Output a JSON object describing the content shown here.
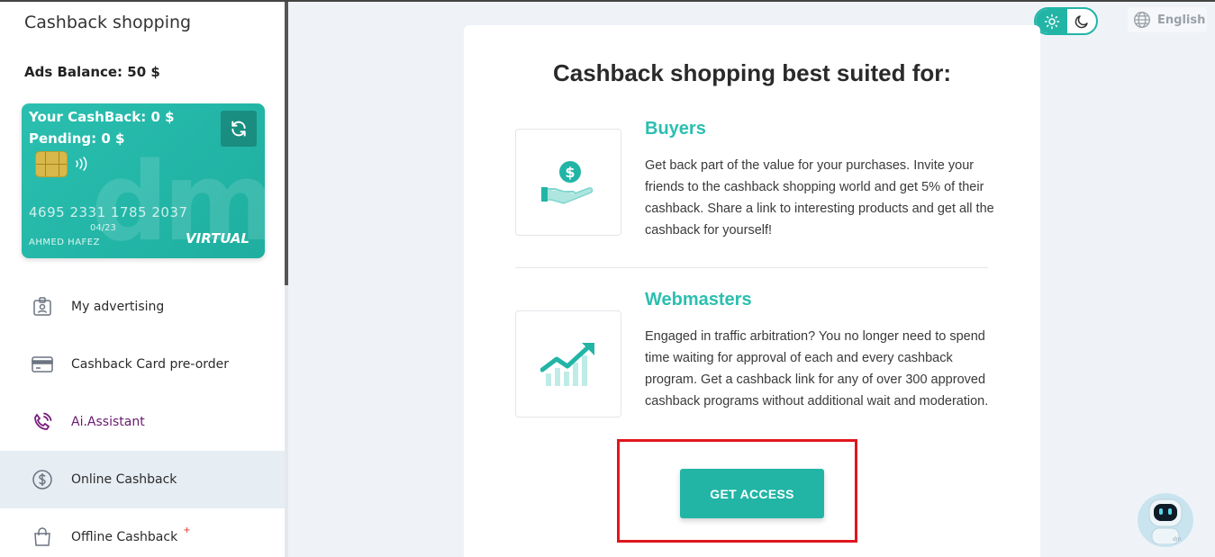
{
  "sidebar": {
    "app_title": "Cashback shopping",
    "ads_balance": "Ads Balance: 50 $",
    "card": {
      "cashback": "Your CashBack: 0 $",
      "pending": "Pending: 0 $",
      "number": "4695 2331 1785 2037",
      "expiry": "04/23",
      "holder": "AHMED HAFEZ",
      "brand": "VIRTUAL",
      "watermark": "dm"
    },
    "items": [
      {
        "label": "My advertising",
        "icon": "badge-icon"
      },
      {
        "label": "Cashback Card pre-order",
        "icon": "credit-card-icon"
      },
      {
        "label": "Ai.Assistant",
        "icon": "phone-call-icon"
      },
      {
        "label": "Online Cashback",
        "icon": "dollar-circle-icon",
        "active": true
      },
      {
        "label": "Offline Cashback",
        "icon": "shopping-bag-icon",
        "badge": "+"
      }
    ]
  },
  "header": {
    "language": "English"
  },
  "main": {
    "title": "Cashback shopping best suited for:",
    "features": [
      {
        "title": "Buyers",
        "text": "Get back part of the value for your purchases. Invite your friends to the cashback shopping world and get 5% of their cashback. Share a link to interesting products and get all the cashback for yourself!",
        "icon": "hand-dollar-icon"
      },
      {
        "title": "Webmasters",
        "text": "Engaged in traffic arbitration? You no longer need to spend time waiting for approval of each and every cashback program. Get a cashback link for any of over 300 approved cashback programs without additional wait and moderation.",
        "icon": "growth-chart-icon"
      }
    ],
    "cta_label": "GET ACCESS"
  },
  "colors": {
    "accent": "#22b5a6",
    "highlight": "#e0161e",
    "ai_purple": "#6a1a6f"
  },
  "robot_badge": "dm"
}
